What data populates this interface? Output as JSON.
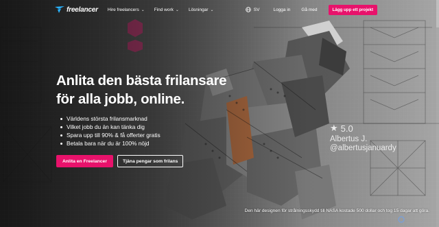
{
  "nav": {
    "logo_text": "freelancer",
    "links": [
      {
        "label": "Hire freelancers"
      },
      {
        "label": "Find work"
      },
      {
        "label": "Lösningar"
      }
    ],
    "lang": "SV",
    "login": "Logga in",
    "signup": "Gå med",
    "post_project": "Lägg upp ett projekt"
  },
  "hero": {
    "headline_line1": "Anlita den bästa frilansare",
    "headline_line2": "för alla jobb, online.",
    "bullets": [
      "Världens största frilansmarknad",
      "Vilket jobb du än kan tänka dig",
      "Spara upp till 90% & få offerter gratis",
      "Betala bara när du är 100% nöjd"
    ],
    "cta_primary": "Anlita en Freelancer",
    "cta_secondary": "Tjäna pengar som frilans"
  },
  "rating": {
    "score": "5.0",
    "name": "Albertus J.",
    "handle": "@albertusjanuardy"
  },
  "caption": "Den här designen för strålningsskydd till NASA kostade 500 dollar och tog 15 dagar att göra.",
  "colors": {
    "accent": "#e8126b",
    "logo": "#29b2fe"
  }
}
